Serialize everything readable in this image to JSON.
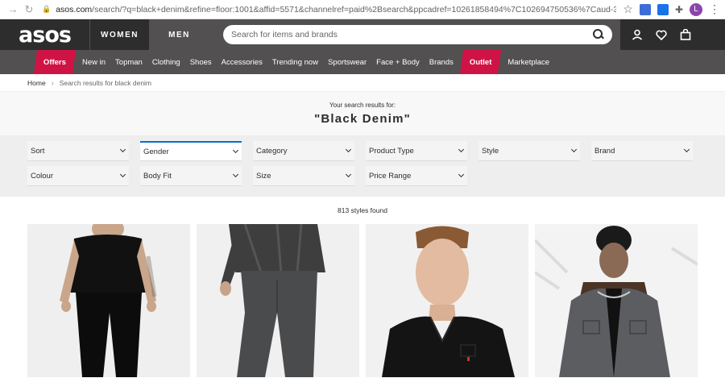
{
  "browser": {
    "url_host": "asos.com",
    "url_rest": "/search/?q=black+denim&refine=floor:1001&affid=5571&channelref=paid%2Bsearch&ppcadref=10261858494%7C102694750536%7Caud-3740146475...",
    "profile_initial": "L"
  },
  "header": {
    "logo": "asos",
    "tabs": [
      "WOMEN",
      "MEN"
    ],
    "active_tab": "MEN",
    "search_placeholder": "Search for items and brands"
  },
  "nav": {
    "items": [
      "Offers",
      "New in",
      "Topman",
      "Clothing",
      "Shoes",
      "Accessories",
      "Trending now",
      "Sportswear",
      "Face + Body",
      "Brands",
      "Outlet",
      "Marketplace"
    ],
    "highlight_color": "#d01345"
  },
  "breadcrumb": {
    "home": "Home",
    "separator": "›",
    "current": "Search results for black denim"
  },
  "results": {
    "subtitle": "Your search results for:",
    "query": "\"Black Denim\"",
    "count": "813 styles found"
  },
  "filters": {
    "row1": [
      "Sort",
      "Gender",
      "Category",
      "Product Type",
      "Style",
      "Brand"
    ],
    "row2": [
      "Colour",
      "Body Fit",
      "Size",
      "Price Range"
    ],
    "active": "Gender",
    "active_color": "#0770cf"
  },
  "products": [
    {
      "name": "black-tshirt-skinny-jeans-product"
    },
    {
      "name": "grey-jeans-product"
    },
    {
      "name": "black-denim-shirt-product"
    },
    {
      "name": "grey-denim-jacket-product"
    }
  ]
}
